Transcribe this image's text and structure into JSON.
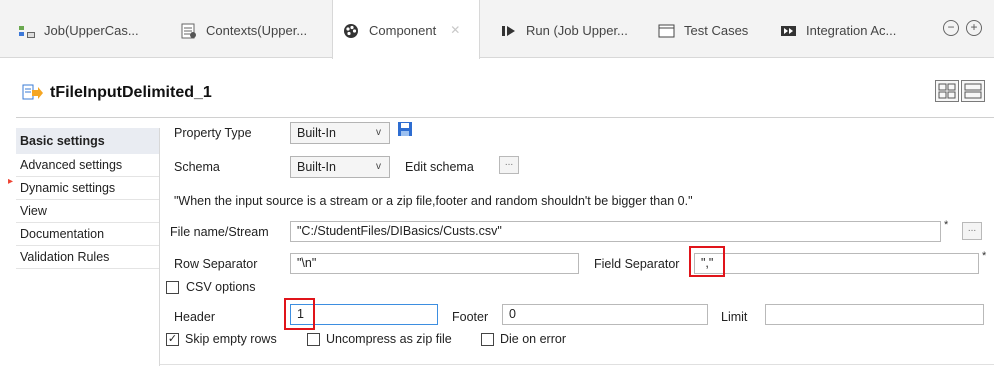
{
  "tabs": [
    {
      "label": "Job(UpperCas...",
      "icon": "job-icon"
    },
    {
      "label": "Contexts(Upper...",
      "icon": "contexts-icon"
    },
    {
      "label": "Component",
      "icon": "component-icon"
    },
    {
      "label": "Run (Job Upper...",
      "icon": "run-icon"
    },
    {
      "label": "Test Cases",
      "icon": "test-cases-icon"
    },
    {
      "label": "Integration Ac...",
      "icon": "integration-icon"
    }
  ],
  "window_controls": {
    "minimize": "−",
    "maximize": "+"
  },
  "component": {
    "name": "tFileInputDelimited_1"
  },
  "nav": [
    {
      "label": "Basic settings"
    },
    {
      "label": "Advanced settings"
    },
    {
      "label": "Dynamic settings"
    },
    {
      "label": "View"
    },
    {
      "label": "Documentation"
    },
    {
      "label": "Validation Rules"
    }
  ],
  "form": {
    "property_type_label": "Property Type",
    "property_type_value": "Built-In",
    "schema_label": "Schema",
    "schema_value": "Built-In",
    "edit_schema_label": "Edit schema",
    "note": "\"When the input source is a stream or a zip file,footer and random shouldn't be bigger than 0.\"",
    "file_name_label": "File name/Stream",
    "file_name_value": "\"C:/StudentFiles/DIBasics/Custs.csv\"",
    "row_separator_label": "Row Separator",
    "row_separator_value": "\"\\n\"",
    "field_separator_label": "Field Separator",
    "field_separator_value": "\",\"",
    "csv_options_label": "CSV options",
    "header_label": "Header",
    "header_value": "1",
    "footer_label": "Footer",
    "footer_value": "0",
    "limit_label": "Limit",
    "limit_value": "",
    "skip_empty_rows_label": "Skip empty rows",
    "uncompress_label": "Uncompress as zip file",
    "die_on_error_label": "Die on error",
    "required_mark": "*",
    "browse_dots": "...",
    "dropdown_arrow": "v"
  },
  "colors": {
    "highlight": "#e0141a",
    "selected_nav_bg": "#e9ecf2"
  }
}
